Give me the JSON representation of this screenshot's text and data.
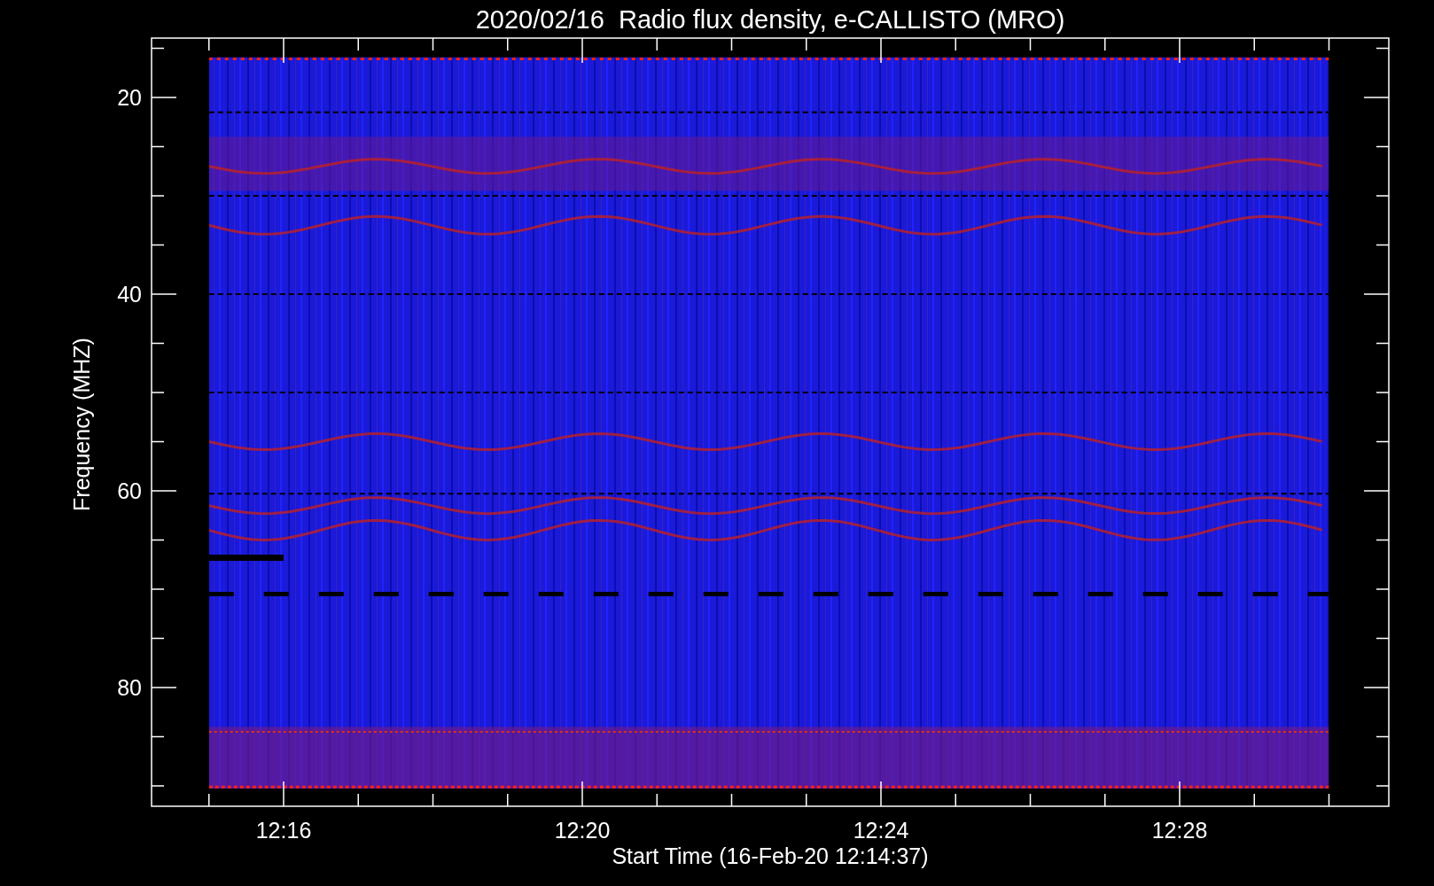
{
  "title": "2020/02/16  Radio flux density, e-CALLISTO (MRO)",
  "y_axis": {
    "label": "Frequency (MHZ)",
    "tick_labels": [
      "20",
      "40",
      "60",
      "80"
    ]
  },
  "x_axis": {
    "label": "Start Time (16-Feb-20 12:14:37)",
    "tick_labels": [
      "12:16",
      "12:20",
      "12:24",
      "12:28"
    ]
  }
}
